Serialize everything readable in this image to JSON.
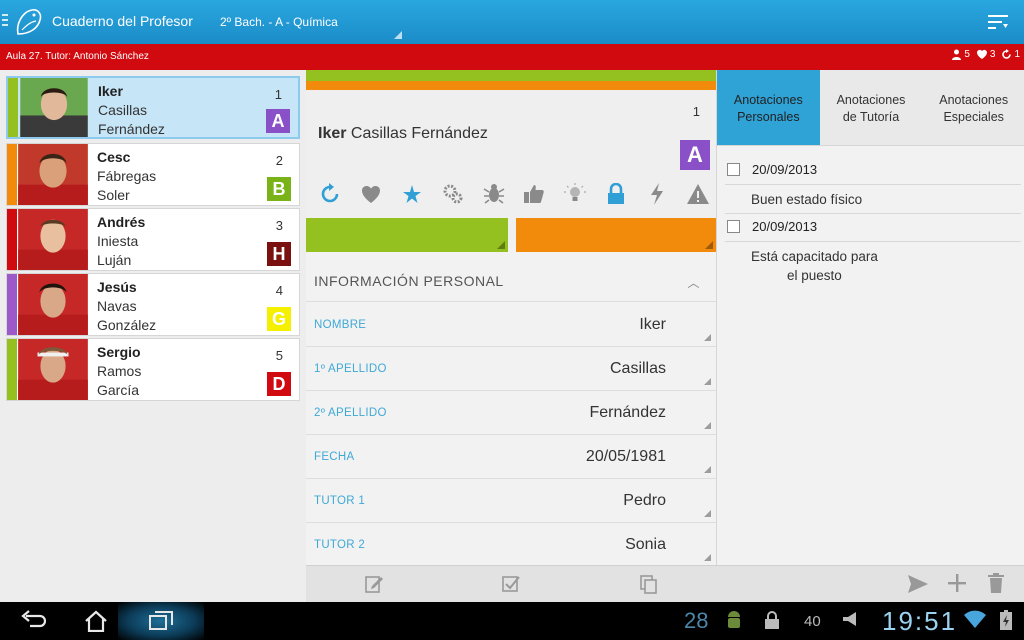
{
  "topbar": {
    "app_title": "Cuaderno del Profesor",
    "course": "2º Bach.  - A - Química"
  },
  "infobar": {
    "tutor": "Aula 27. Tutor: Antonio Sánchez",
    "stats": {
      "students": "5",
      "likes": "3",
      "updates": "1"
    }
  },
  "students": [
    {
      "first": "Iker",
      "last1": "Casillas",
      "last2": "Fernández",
      "num": "1",
      "grade": "A",
      "grade_color": "#8950c8",
      "side_color": "#94c11f",
      "selected": true
    },
    {
      "first": "Cesc",
      "last1": "Fábregas",
      "last2": "Soler",
      "num": "2",
      "grade": "B",
      "grade_color": "#7ab317",
      "side_color": "#f28a0c"
    },
    {
      "first": "Andrés",
      "last1": "Iniesta",
      "last2": "Luján",
      "num": "3",
      "grade": "H",
      "grade_color": "#7a1010",
      "side_color": "#d10a10"
    },
    {
      "first": "Jesús",
      "last1": "Navas",
      "last2": "González",
      "num": "4",
      "grade": "G",
      "grade_color": "#f5ef00",
      "side_color": "#9b5ac8"
    },
    {
      "first": "Sergio",
      "last1": "Ramos",
      "last2": "García",
      "num": "5",
      "grade": "D",
      "grade_color": "#d10a10",
      "side_color": "#94c11f"
    }
  ],
  "detail": {
    "first": "Iker",
    "rest": "Casillas Fernández",
    "num": "1",
    "grade": "A",
    "section": "INFORMACIÓN PERSONAL",
    "fields": [
      {
        "label": "NOMBRE",
        "value": "Iker"
      },
      {
        "label": "1º APELLIDO",
        "value": "Casillas"
      },
      {
        "label": "2º APELLIDO",
        "value": "Fernández"
      },
      {
        "label": "FECHA",
        "value": "20/05/1981"
      },
      {
        "label": "TUTOR 1",
        "value": "Pedro"
      },
      {
        "label": "TUTOR 2",
        "value": "Sonia"
      }
    ]
  },
  "tabs": {
    "personal": {
      "line1": "Anotaciones",
      "line2": "Personales"
    },
    "tutoria": {
      "line1": "Anotaciones",
      "line2": "de Tutoría"
    },
    "especiales": {
      "line1": "Anotaciones",
      "line2": "Especiales"
    }
  },
  "notes": [
    {
      "date": "20/09/2013",
      "text": "Buen estado físico"
    },
    {
      "date": "20/09/2013",
      "text_line1": "Está capacitado para",
      "text_line2": "el puesto"
    }
  ],
  "system": {
    "day": "28",
    "battery": "40",
    "time": "19:51"
  },
  "colors": {
    "accent": "#1b8cc8",
    "red": "#d10a10",
    "green": "#94c11f",
    "orange": "#f28a0c",
    "purple": "#8950c8"
  }
}
